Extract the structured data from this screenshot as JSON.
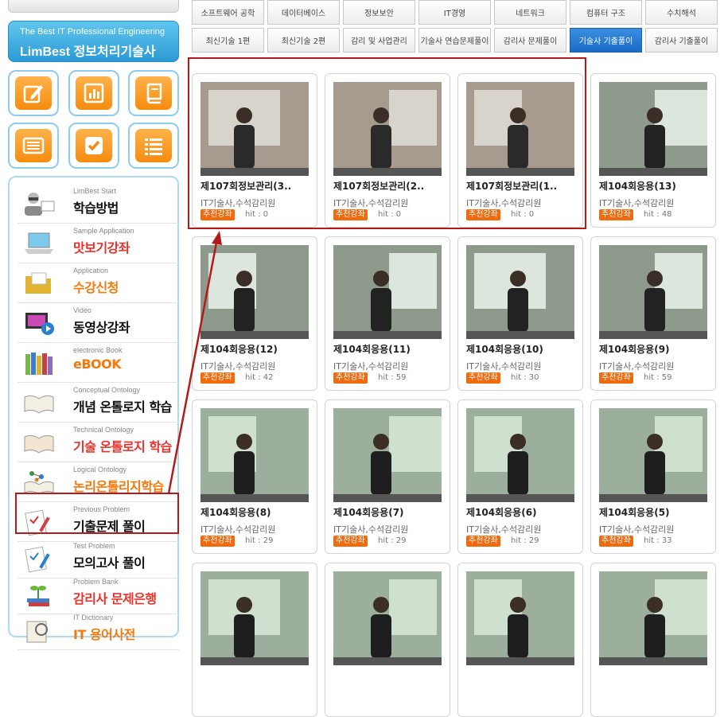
{
  "sidebar": {
    "logo_line1": "The Best IT Professional Engineering",
    "logo_line2": "LimBest 정보처리기술사",
    "quick_icons": [
      "pencil-icon",
      "bar-chart-icon",
      "book-icon",
      "list-card-icon",
      "checkbox-icon",
      "list-icon"
    ],
    "menu": [
      {
        "small": "LimBest Start",
        "big": "학습방법",
        "color": "dark"
      },
      {
        "small": "Sample Application",
        "big": "맛보기강좌",
        "color": "red"
      },
      {
        "small": "Application",
        "big": "수강신청",
        "color": "orange"
      },
      {
        "small": "Video",
        "big": "동영상강좌",
        "color": "dark"
      },
      {
        "small": "electronic Book",
        "big": "eBOOK",
        "color": "orange"
      },
      {
        "small": "Conceptual Ontology",
        "big": "개념 온톨로지 학습",
        "color": "dark"
      },
      {
        "small": "Technical Ontology",
        "big": "기술 온톨로지 학습",
        "color": "red"
      },
      {
        "small": "Logical Ontology",
        "big": "논리온톨리지학습",
        "color": "orange"
      },
      {
        "small": "Previous Problem",
        "big": "기출문제 풀이",
        "color": "dark"
      },
      {
        "small": "Test Problem",
        "big": "모의고사 풀이",
        "color": "dark"
      },
      {
        "small": "Problem Bank",
        "big": "감리사 문제은행",
        "color": "red"
      },
      {
        "small": "IT Dictionary",
        "big": "IT 용어사전",
        "color": "orange"
      }
    ]
  },
  "tabs": [
    {
      "label": "소프트웨어 공학",
      "active": false
    },
    {
      "label": "데이터베이스",
      "active": false
    },
    {
      "label": "정보보안",
      "active": false
    },
    {
      "label": "IT경영",
      "active": false
    },
    {
      "label": "네트워크",
      "active": false
    },
    {
      "label": "컴퓨터 구조",
      "active": false
    },
    {
      "label": "수치해석",
      "active": false
    },
    {
      "label": "최신기술 1편",
      "active": false
    },
    {
      "label": "최신기술 2편",
      "active": false
    },
    {
      "label": "감리 및 사업관리",
      "active": false
    },
    {
      "label": "기술사 연습문제풀이",
      "active": false
    },
    {
      "label": "감리사 문제풀이",
      "active": false
    },
    {
      "label": "기술사 기출풀이",
      "active": true
    },
    {
      "label": "감리사 기출풀이",
      "active": false
    }
  ],
  "cards": [
    {
      "title": "제107회정보관리(3..",
      "sub": "IT기술사,수석감리원",
      "badge": "추천강좌",
      "hit": "hit : 0"
    },
    {
      "title": "제107회정보관리(2..",
      "sub": "IT기술사,수석감리원",
      "badge": "추천강좌",
      "hit": "hit : 0"
    },
    {
      "title": "제107회정보관리(1..",
      "sub": "IT기술사,수석감리원",
      "badge": "추천강좌",
      "hit": "hit : 0"
    },
    {
      "title": "제104회응용(13)",
      "sub": "IT기술사,수석감리원",
      "badge": "추천강좌",
      "hit": "hit : 48"
    },
    {
      "title": "제104회응용(12)",
      "sub": "IT기술사,수석감리원",
      "badge": "추천강좌",
      "hit": "hit : 42"
    },
    {
      "title": "제104회응용(11)",
      "sub": "IT기술사,수석감리원",
      "badge": "추천강좌",
      "hit": "hit : 59"
    },
    {
      "title": "제104회응용(10)",
      "sub": "IT기술사,수석감리원",
      "badge": "추천강좌",
      "hit": "hit : 30"
    },
    {
      "title": "제104회응용(9)",
      "sub": "IT기술사,수석감리원",
      "badge": "추천강좌",
      "hit": "hit : 59"
    },
    {
      "title": "제104회응용(8)",
      "sub": "IT기술사,수석감리원",
      "badge": "추천강좌",
      "hit": "hit : 29"
    },
    {
      "title": "제104회응용(7)",
      "sub": "IT기술사,수석감리원",
      "badge": "추천강좌",
      "hit": "hit : 29"
    },
    {
      "title": "제104회응용(6)",
      "sub": "IT기술사,수석감리원",
      "badge": "추천강좌",
      "hit": "hit : 29"
    },
    {
      "title": "제104회응용(5)",
      "sub": "IT기술사,수석감리원",
      "badge": "추천강좌",
      "hit": "hit : 33"
    },
    {
      "title": "",
      "sub": "",
      "badge": "",
      "hit": ""
    },
    {
      "title": "",
      "sub": "",
      "badge": "",
      "hit": ""
    },
    {
      "title": "",
      "sub": "",
      "badge": "",
      "hit": ""
    },
    {
      "title": "",
      "sub": "",
      "badge": "",
      "hit": ""
    }
  ],
  "colors": {
    "accent_blue": "#1a6cc6",
    "badge_orange": "#f26a0e",
    "highlight_red": "#b31b1b",
    "sidebar_border": "#a9dcf5"
  }
}
